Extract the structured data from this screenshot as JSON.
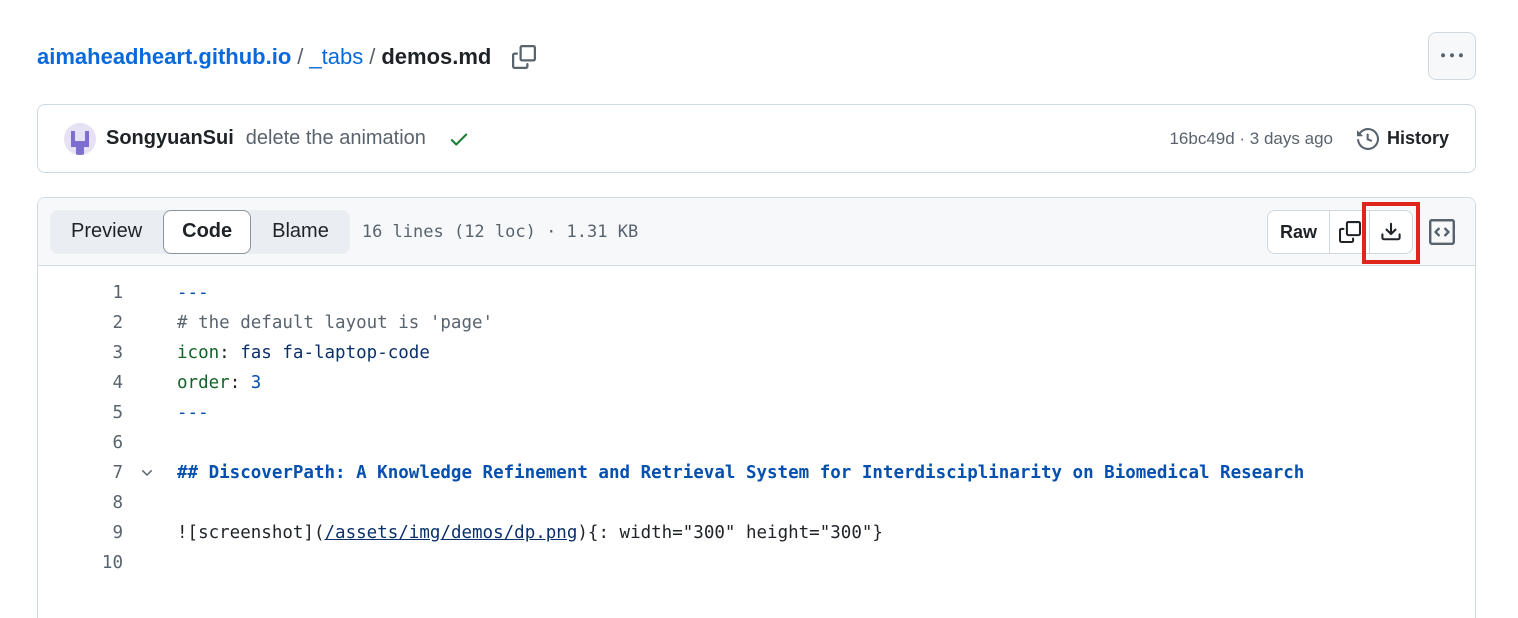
{
  "breadcrumb": {
    "repo": "aimaheadheart.github.io",
    "sep1": "/",
    "folder": "_tabs",
    "sep2": "/",
    "file": "demos.md"
  },
  "commit": {
    "author": "SongyuanSui",
    "message": "delete the animation",
    "meta": "16bc49d · 3 days ago",
    "history_label": "History"
  },
  "tabs": {
    "preview": "Preview",
    "code": "Code",
    "blame": "Blame"
  },
  "file_info": "16 lines (12 loc) · 1.31 KB",
  "actions": {
    "raw": "Raw"
  },
  "code_lines": [
    {
      "n": "1",
      "parts": [
        "---"
      ]
    },
    {
      "n": "2",
      "parts": [
        "# the default layout is 'page'"
      ]
    },
    {
      "n": "3",
      "parts": [
        "icon",
        ": ",
        "fas fa-laptop-code"
      ]
    },
    {
      "n": "4",
      "parts": [
        "order",
        ": ",
        "3"
      ]
    },
    {
      "n": "5",
      "parts": [
        "---"
      ]
    },
    {
      "n": "6",
      "parts": []
    },
    {
      "n": "7",
      "parts": [
        "## DiscoverPath: A Knowledge Refinement and Retrieval System for Interdisciplinarity on Biomedical Research"
      ]
    },
    {
      "n": "8",
      "parts": []
    },
    {
      "n": "9",
      "parts": [
        "![screenshot](",
        "/assets/img/demos/dp.png",
        "){: width=\"300\" height=\"300\"}"
      ]
    },
    {
      "n": "10",
      "parts": []
    }
  ],
  "colors": {
    "link": "#0969da",
    "highlight": "#e0251b",
    "check": "#1a7f37"
  },
  "icons": [
    "copy-icon",
    "kebab-icon",
    "check-icon",
    "history-icon",
    "download-icon",
    "symbols-icon",
    "chevron-down-icon"
  ]
}
